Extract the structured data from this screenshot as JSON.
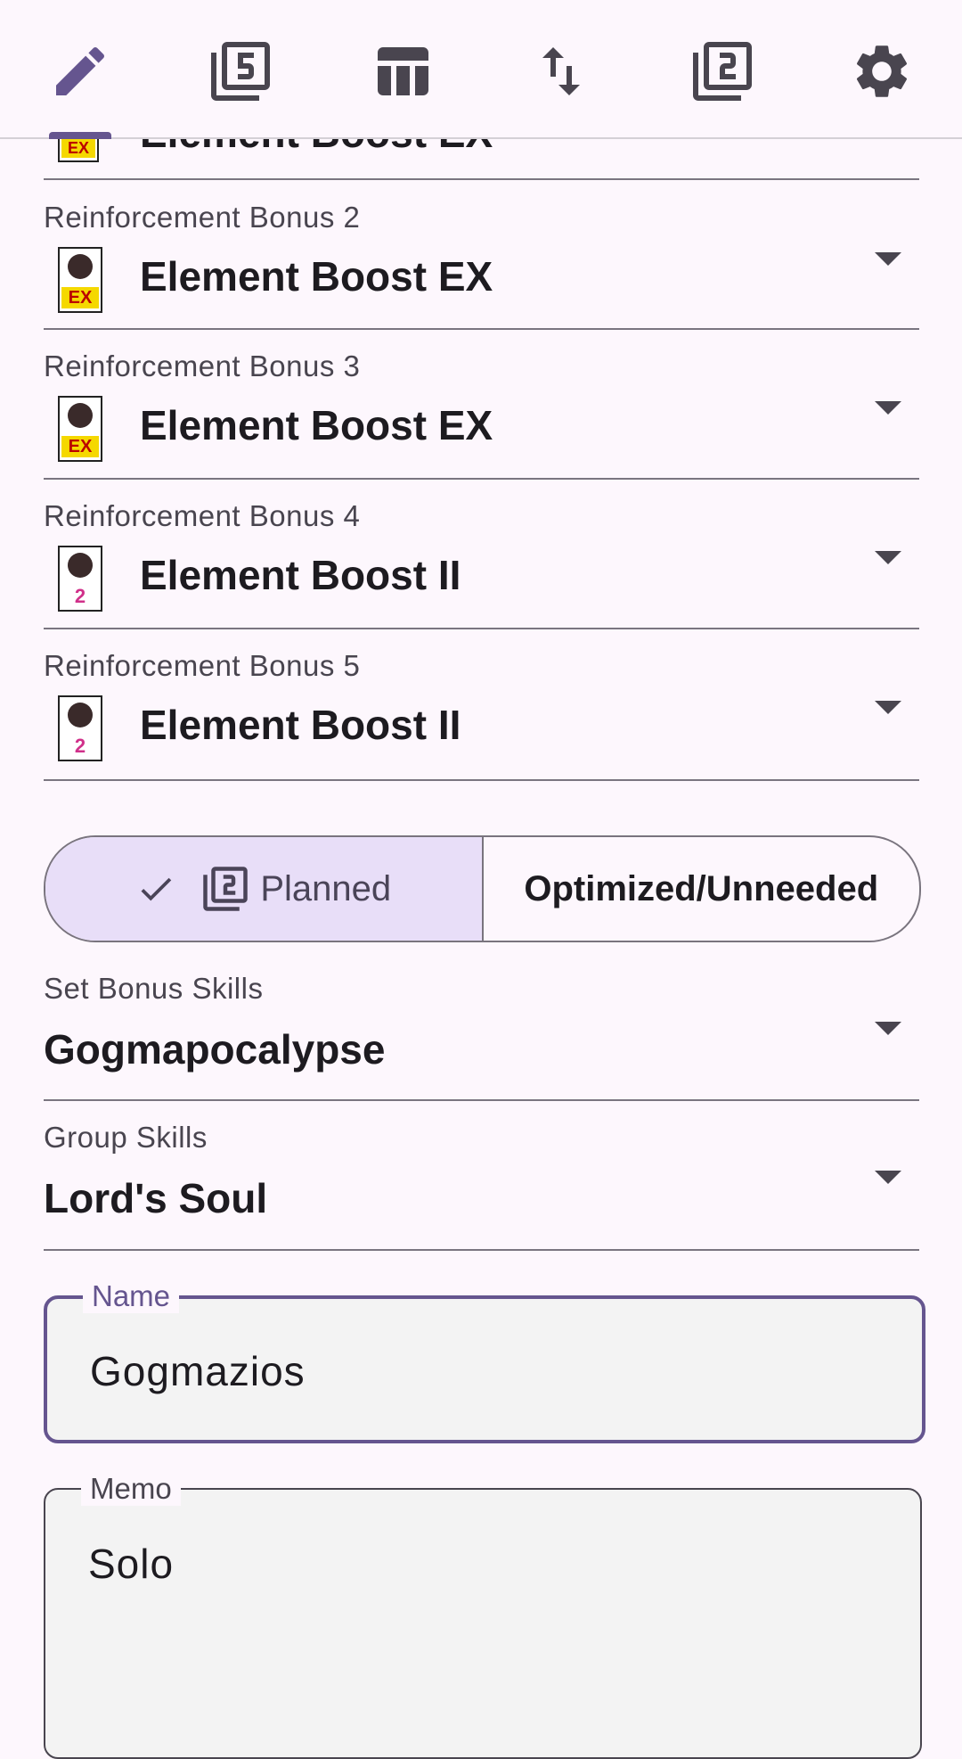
{
  "nav": {
    "items": [
      {
        "name": "edit",
        "icon": "pencil-icon"
      },
      {
        "name": "filter-5",
        "icon": "filter-5-icon"
      },
      {
        "name": "table",
        "icon": "table-icon"
      },
      {
        "name": "sort",
        "icon": "swap-vert-icon"
      },
      {
        "name": "filter-2",
        "icon": "filter-2-icon"
      },
      {
        "name": "settings",
        "icon": "gear-icon"
      }
    ],
    "accent": "#65558f"
  },
  "bonuses": [
    {
      "label": "",
      "value": "Element Boost EX",
      "badge": "EX"
    },
    {
      "label": "Reinforcement Bonus 2",
      "value": "Element Boost EX",
      "badge": "EX"
    },
    {
      "label": "Reinforcement Bonus 3",
      "value": "Element Boost EX",
      "badge": "EX"
    },
    {
      "label": "Reinforcement Bonus 4",
      "value": "Element Boost II",
      "badge": "2"
    },
    {
      "label": "Reinforcement Bonus 5",
      "value": "Element Boost II",
      "badge": "2"
    }
  ],
  "segmented": {
    "planned_label": "Planned",
    "optimized_label": "Optimized/Unneeded",
    "selected": "Planned"
  },
  "set_bonus": {
    "label": "Set Bonus Skills",
    "value": "Gogmapocalypse"
  },
  "group_skills": {
    "label": "Group Skills",
    "value": "Lord's Soul"
  },
  "name_field": {
    "label": "Name",
    "value": "Gogmazios"
  },
  "memo_field": {
    "label": "Memo",
    "value": "Solo"
  }
}
